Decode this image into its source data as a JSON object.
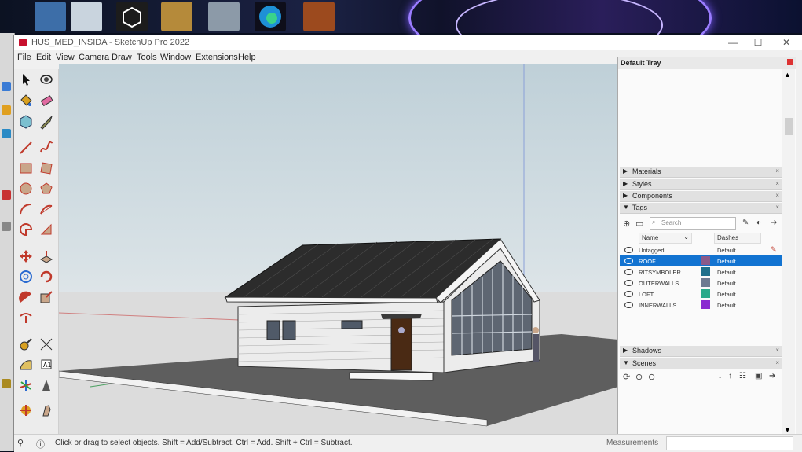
{
  "window": {
    "title": "HUS_MED_INSIDA - SketchUp Pro 2022",
    "minimize": "—",
    "maximize": "☐",
    "close": "✕"
  },
  "menu": [
    "File",
    "Edit",
    "View",
    "Camera",
    "Draw",
    "Tools",
    "Window",
    "Extensions",
    "Help"
  ],
  "tray": {
    "title": "Default Tray",
    "sections_top": [
      {
        "label": "Materials",
        "arrow": "▶"
      },
      {
        "label": "Styles",
        "arrow": "▶"
      },
      {
        "label": "Components",
        "arrow": "▶"
      },
      {
        "label": "Tags",
        "arrow": "▼"
      }
    ],
    "tags": {
      "search_placeholder": "Search",
      "col_name": "Name",
      "col_dashes": "Dashes",
      "rows": [
        {
          "name": "Untagged",
          "color": "",
          "dashes": "Default",
          "selected": false
        },
        {
          "name": "ROOF",
          "color": "#8a5a8a",
          "dashes": "Default",
          "selected": true
        },
        {
          "name": "RITSYMBOLER",
          "color": "#1f6f8b",
          "dashes": "Default",
          "selected": false
        },
        {
          "name": "OUTERWALLS",
          "color": "#6d7a91",
          "dashes": "Default",
          "selected": false
        },
        {
          "name": "LOFT",
          "color": "#2aaa8a",
          "dashes": "Default",
          "selected": false
        },
        {
          "name": "INNERWALLS",
          "color": "#8a2ad0",
          "dashes": "Default",
          "selected": false
        }
      ]
    },
    "sections_bottom": [
      {
        "label": "Shadows",
        "arrow": "▶"
      },
      {
        "label": "Scenes",
        "arrow": "▼"
      }
    ]
  },
  "status": {
    "hint": "Click or drag to select objects. Shift = Add/Subtract. Ctrl = Add. Shift + Ctrl = Subtract.",
    "measurements_label": "Measurements"
  }
}
